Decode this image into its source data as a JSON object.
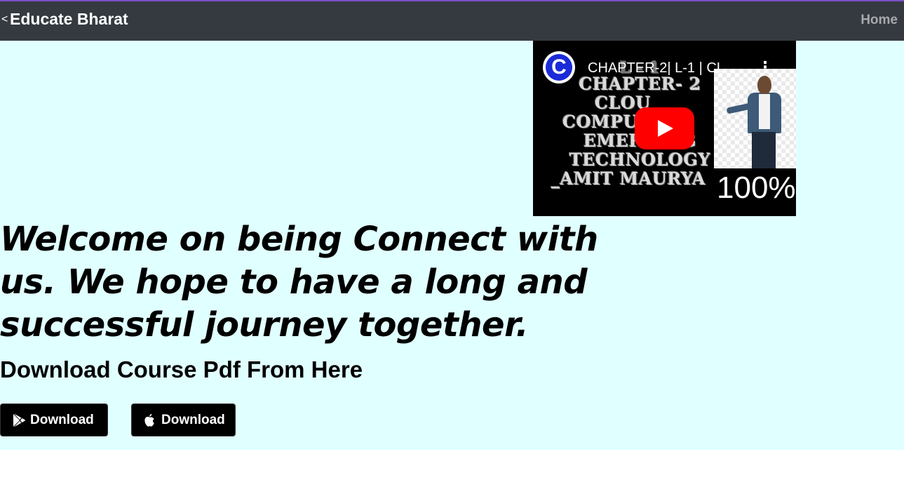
{
  "navbar": {
    "brand_prefix": "<",
    "brand": "Educate Bharat",
    "home_link": "Home"
  },
  "video": {
    "channel_logo_letter": "C",
    "title": "CHAPTER-2| L-1 | CL...",
    "menu_icon": "kebab-icon",
    "thumbnail_lines": [
      "L - 1",
      "CHAPTER- 2",
      "CLOU",
      "COMPU",
      "EMERGING",
      "TECHNOLOGY",
      "_AMIT MAURYA"
    ],
    "thumbnail_percent": "100%",
    "play_icon": "play-icon"
  },
  "hero": {
    "welcome_text": "Welcome on being Connect with us. We hope to have a long and successful journey together.",
    "download_heading": "Download Course Pdf From Here"
  },
  "buttons": [
    {
      "label": "Download",
      "icon": "google-play-icon"
    },
    {
      "label": "Download",
      "icon": "apple-icon"
    }
  ],
  "colors": {
    "navbar_bg": "#343a40",
    "navbar_border": "#7b4fc9",
    "hero_bg": "#e0ffff",
    "button_bg": "#000000",
    "play_button": "#ff0000",
    "channel_logo": "#1b2bd8"
  }
}
